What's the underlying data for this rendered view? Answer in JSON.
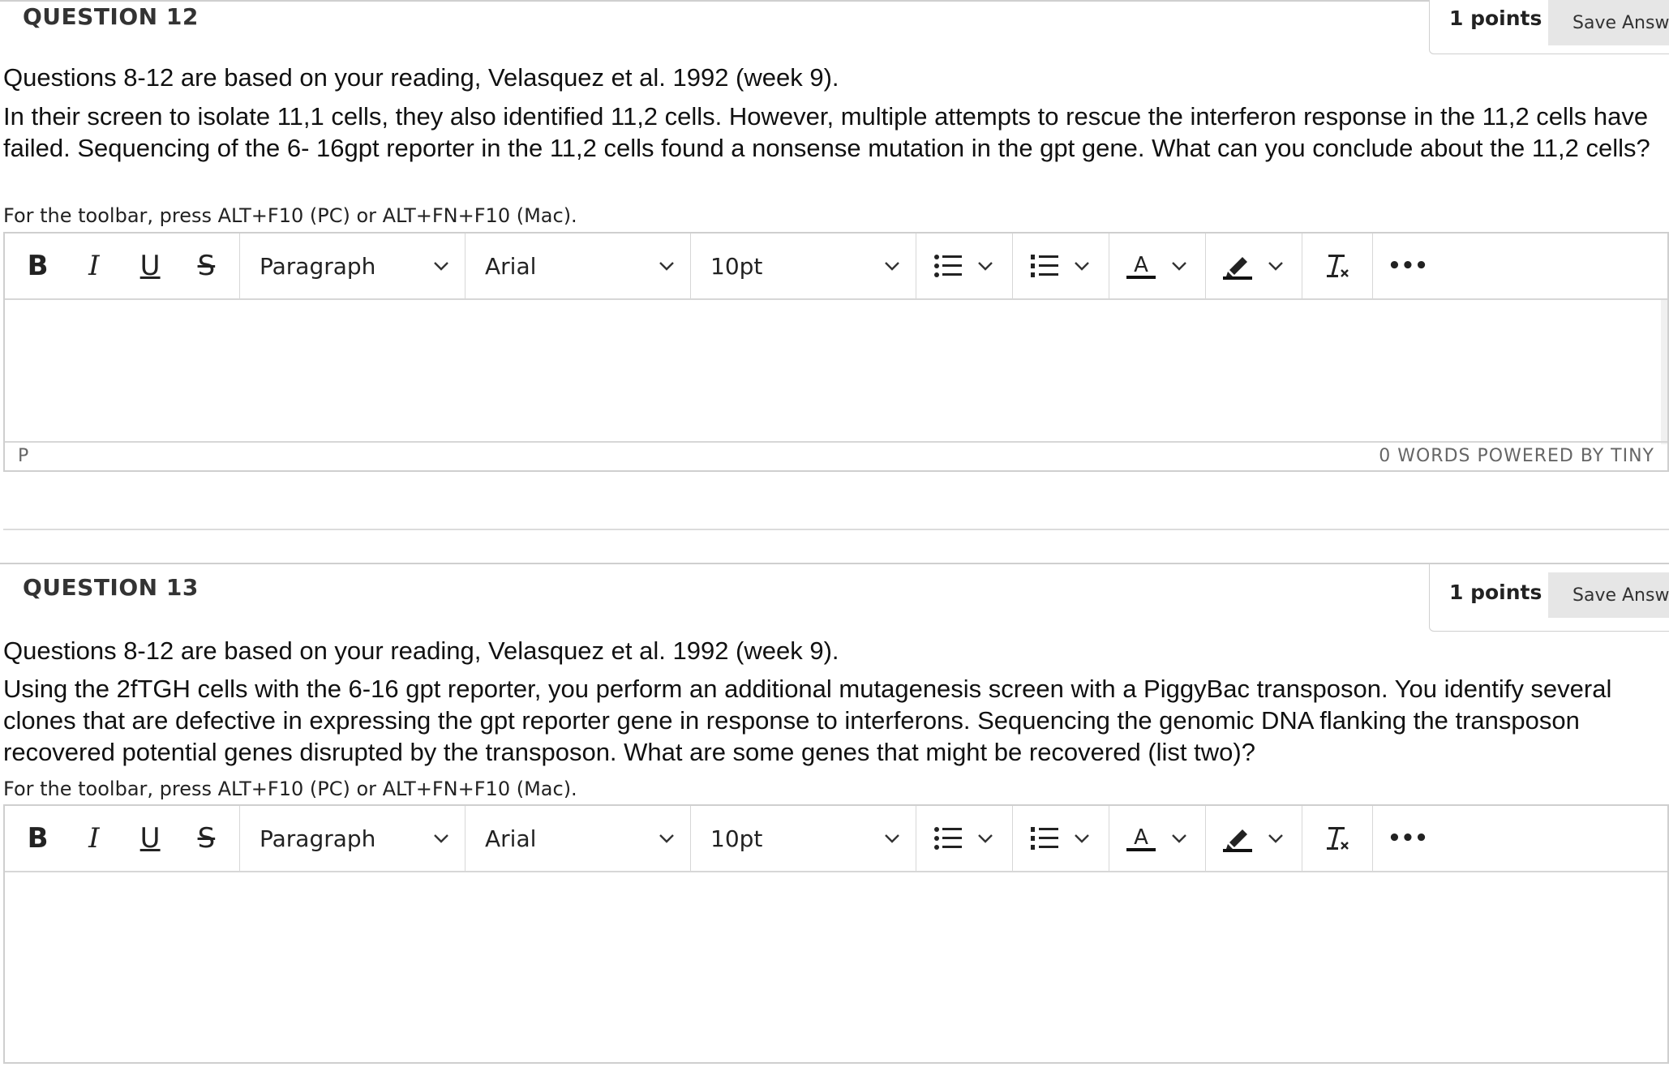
{
  "questions": [
    {
      "title": "QUESTION 12",
      "points": "1 points",
      "save_label": "Save Answer",
      "intro": "Questions 8-12 are based on your reading, Velasquez et al. 1992 (week 9).",
      "text": "In their screen to isolate 11,1 cells, they also identified 11,2 cells. However, multiple attempts to rescue the interferon response in the 11,2 cells have failed. Sequencing of the 6- 16gpt reporter in the 11,2 cells found a nonsense mutation in the gpt gene. What can you conclude about the 11,2 cells?",
      "toolbar_hint": "For the toolbar, press ALT+F10 (PC) or ALT+FN+F10 (Mac).",
      "format_select": "Paragraph",
      "font_select": "Arial",
      "size_select": "10pt",
      "status_path": "P",
      "status_right": "0 WORDS  POWERED BY TINY"
    },
    {
      "title": "QUESTION 13",
      "points": "1 points",
      "save_label": "Save Answer",
      "intro": "Questions 8-12 are based on your reading, Velasquez et al. 1992 (week 9).",
      "text": "Using the 2fTGH cells with the 6-16 gpt reporter, you perform an additional mutagenesis screen with a PiggyBac transposon. You identify several clones that are defective in expressing the gpt reporter gene in response to interferons. Sequencing the genomic DNA flanking the transposon recovered potential genes disrupted by the transposon. What are some genes that might be recovered (list two)?",
      "toolbar_hint": "For the toolbar, press ALT+F10 (PC) or ALT+FN+F10 (Mac).",
      "format_select": "Paragraph",
      "font_select": "Arial",
      "size_select": "10pt"
    }
  ],
  "toolbar_icons": {
    "bold": "B",
    "italic": "I",
    "underline": "U",
    "strikethrough": "S",
    "more": "•••"
  }
}
